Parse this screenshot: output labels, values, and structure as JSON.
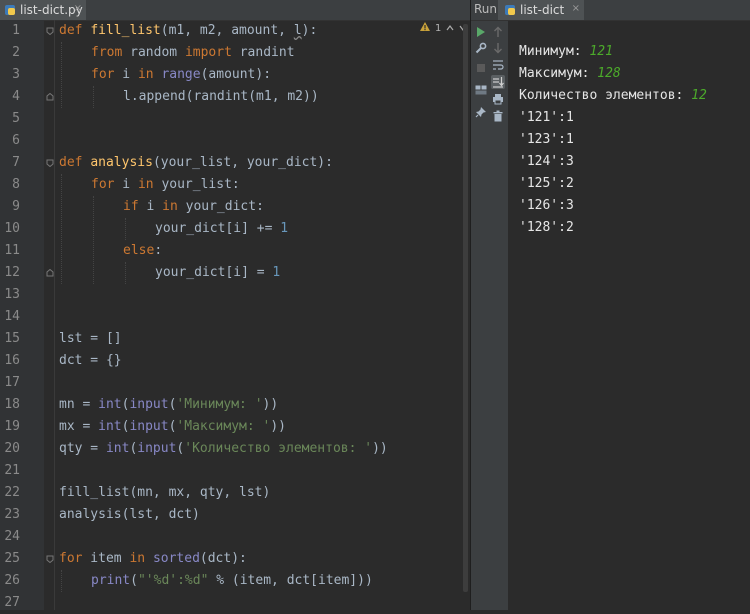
{
  "editor": {
    "tab": {
      "label": "list-dict.py",
      "close": "×"
    },
    "inspection": {
      "warnings": "1"
    },
    "lines": [
      {
        "n": "1"
      },
      {
        "n": "2"
      },
      {
        "n": "3"
      },
      {
        "n": "4"
      },
      {
        "n": "5"
      },
      {
        "n": "6"
      },
      {
        "n": "7"
      },
      {
        "n": "8"
      },
      {
        "n": "9"
      },
      {
        "n": "10"
      },
      {
        "n": "11"
      },
      {
        "n": "12"
      },
      {
        "n": "13"
      },
      {
        "n": "14"
      },
      {
        "n": "15"
      },
      {
        "n": "16"
      },
      {
        "n": "17"
      },
      {
        "n": "18"
      },
      {
        "n": "19"
      },
      {
        "n": "20"
      },
      {
        "n": "21"
      },
      {
        "n": "22"
      },
      {
        "n": "23"
      },
      {
        "n": "24"
      },
      {
        "n": "25"
      },
      {
        "n": "26"
      },
      {
        "n": "27"
      }
    ],
    "code": {
      "l1": [
        "def",
        " ",
        "fill_list",
        "(m1, m2, amount, ",
        "l",
        "):"
      ],
      "l2": [
        "from",
        " random ",
        "import",
        " randint"
      ],
      "l3": [
        "for",
        " i ",
        "in",
        " ",
        "range",
        "(amount):"
      ],
      "l4": [
        "l.append(randint(m1, m2))"
      ],
      "l7": [
        "def",
        " ",
        "analysis",
        "(your_list, your_dict):"
      ],
      "l8": [
        "for",
        " i ",
        "in",
        " your_list:"
      ],
      "l9": [
        "if",
        " i ",
        "in",
        " your_dict:"
      ],
      "l10": [
        "your_dict[i] += ",
        "1"
      ],
      "l11": [
        "else",
        ":"
      ],
      "l12": [
        "your_dict[i] = ",
        "1"
      ],
      "l15": [
        "lst = []"
      ],
      "l16": [
        "dct = {}"
      ],
      "l18": [
        "mn = ",
        "int",
        "(",
        "input",
        "(",
        "'Минимум: '",
        "))"
      ],
      "l19": [
        "mx = ",
        "int",
        "(",
        "input",
        "(",
        "'Максимум: '",
        "))"
      ],
      "l20": [
        "qty = ",
        "int",
        "(",
        "input",
        "(",
        "'Количество элементов: '",
        "))"
      ],
      "l22": [
        "fill_list(mn, mx, qty, lst)"
      ],
      "l23": [
        "analysis(lst, dct)"
      ],
      "l25": [
        "for",
        " item ",
        "in",
        " ",
        "sorted",
        "(dct):"
      ],
      "l26": [
        "print",
        "(",
        "\"'%d':%d\"",
        " % (item, dct[item]))"
      ]
    }
  },
  "run": {
    "label": "Run:",
    "tab": {
      "label": "list-dict",
      "close": "×"
    },
    "output": [
      {
        "text": "Минимум: ",
        "input": "121"
      },
      {
        "text": "Максимум: ",
        "input": "128"
      },
      {
        "text": "Количество элементов: ",
        "input": "12"
      },
      {
        "text": "'121':1"
      },
      {
        "text": "'123':1"
      },
      {
        "text": "'124':3"
      },
      {
        "text": "'125':2"
      },
      {
        "text": "'126':3"
      },
      {
        "text": "'128':2"
      }
    ]
  },
  "colors": {
    "keyword": "#cc7832",
    "function": "#ffc66d",
    "builtin": "#8888c6",
    "string": "#6a8759",
    "number": "#6897bb",
    "user_input": "#4caa2b"
  }
}
